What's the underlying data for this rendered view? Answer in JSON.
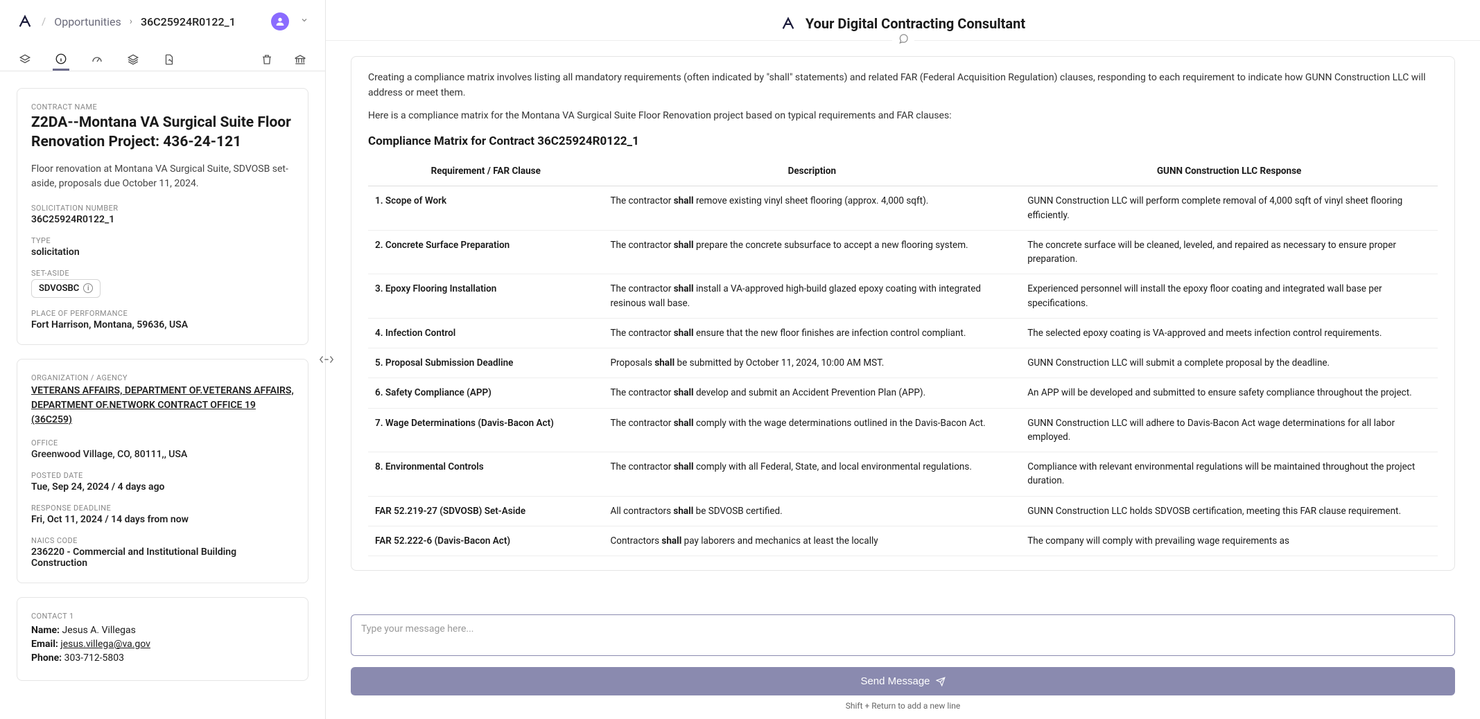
{
  "breadcrumb": {
    "root": "Opportunities",
    "id": "36C25924R0122_1"
  },
  "contract": {
    "label_name": "Contract Name",
    "name": "Z2DA--Montana VA Surgical Suite Floor Renovation Project: 436-24-121",
    "summary": "Floor renovation at Montana VA Surgical Suite, SDVOSB set-aside, proposals due October 11, 2024.",
    "label_solicitation": "SOLICITATION NUMBER",
    "solicitation": "36C25924R0122_1",
    "label_type": "TYPE",
    "type": "solicitation",
    "label_setaside": "SET-ASIDE",
    "setaside": "SDVOSBC",
    "label_pop": "PLACE OF PERFORMANCE",
    "pop": "Fort Harrison, Montana, 59636, USA"
  },
  "org": {
    "label_org": "ORGANIZATION / AGENCY",
    "name": "VETERANS AFFAIRS, DEPARTMENT OF.VETERANS AFFAIRS, DEPARTMENT OF.NETWORK CONTRACT OFFICE 19 (36C259)",
    "label_office": "OFFICE",
    "office": "Greenwood Village, CO, 80111,, USA",
    "label_posted": "POSTED DATE",
    "posted": "Tue, Sep 24, 2024 / 4 days ago",
    "label_deadline": "RESPONSE DEADLINE",
    "deadline": "Fri, Oct 11, 2024 / 14 days from now",
    "label_naics": "NAICS CODE",
    "naics": "236220 - Commercial and Institutional Building Construction"
  },
  "contact": {
    "heading": "Contact 1",
    "name_label": "Name:",
    "name": "Jesus A. Villegas",
    "email_label": "Email:",
    "email": "jesus.villega@va.gov",
    "phone_label": "Phone:",
    "phone": "303-712-5803"
  },
  "right": {
    "title": "Your Digital Contracting Consultant",
    "p1": "Creating a compliance matrix involves listing all mandatory requirements (often indicated by \"shall\" statements) and related FAR (Federal Acquisition Regulation) clauses, responding to each requirement to indicate how GUNN Construction LLC will address or meet them.",
    "p2": "Here is a compliance matrix for the Montana VA Surgical Suite Floor Renovation project based on typical requirements and FAR clauses:",
    "matrix_title": "Compliance Matrix for Contract 36C25924R0122_1",
    "headers": {
      "a": "Requirement / FAR Clause",
      "b": "Description",
      "c": "GUNN Construction LLC Response"
    },
    "rows": [
      {
        "a": "1. Scope of Work",
        "b_pre": "The contractor ",
        "b_shall": "shall",
        "b_post": " remove existing vinyl sheet flooring (approx. 4,000 sqft).",
        "c": "GUNN Construction LLC will perform complete removal of 4,000 sqft of vinyl sheet flooring efficiently."
      },
      {
        "a": "2. Concrete Surface Preparation",
        "b_pre": "The contractor ",
        "b_shall": "shall",
        "b_post": " prepare the concrete subsurface to accept a new flooring system.",
        "c": "The concrete surface will be cleaned, leveled, and repaired as necessary to ensure proper preparation."
      },
      {
        "a": "3. Epoxy Flooring Installation",
        "b_pre": "The contractor ",
        "b_shall": "shall",
        "b_post": " install a VA-approved high-build glazed epoxy coating with integrated resinous wall base.",
        "c": "Experienced personnel will install the epoxy floor coating and integrated wall base per specifications."
      },
      {
        "a": "4. Infection Control",
        "b_pre": "The contractor ",
        "b_shall": "shall",
        "b_post": " ensure that the new floor finishes are infection control compliant.",
        "c": "The selected epoxy coating is VA-approved and meets infection control requirements."
      },
      {
        "a": "5. Proposal Submission Deadline",
        "b_pre": "Proposals ",
        "b_shall": "shall",
        "b_post": " be submitted by October 11, 2024, 10:00 AM MST.",
        "c": "GUNN Construction LLC will submit a complete proposal by the deadline."
      },
      {
        "a": "6. Safety Compliance (APP)",
        "b_pre": "The contractor ",
        "b_shall": "shall",
        "b_post": " develop and submit an Accident Prevention Plan (APP).",
        "c": "An APP will be developed and submitted to ensure safety compliance throughout the project."
      },
      {
        "a": "7. Wage Determinations (Davis-Bacon Act)",
        "b_pre": "The contractor ",
        "b_shall": "shall",
        "b_post": " comply with the wage determinations outlined in the Davis-Bacon Act.",
        "c": "GUNN Construction LLC will adhere to Davis-Bacon Act wage determinations for all labor employed."
      },
      {
        "a": "8. Environmental Controls",
        "b_pre": "The contractor ",
        "b_shall": "shall",
        "b_post": " comply with all Federal, State, and local environmental regulations.",
        "c": "Compliance with relevant environmental regulations will be maintained throughout the project duration."
      },
      {
        "a": "FAR 52.219-27 (SDVOSB) Set-Aside",
        "b_pre": "All contractors ",
        "b_shall": "shall",
        "b_post": " be SDVOSB certified.",
        "c": "GUNN Construction LLC holds SDVOSB certification, meeting this FAR clause requirement."
      },
      {
        "a": "FAR 52.222-6 (Davis-Bacon Act)",
        "b_pre": "Contractors ",
        "b_shall": "shall",
        "b_post": " pay laborers and mechanics at least the locally",
        "c": "The company will comply with prevailing wage requirements as"
      }
    ]
  },
  "composer": {
    "placeholder": "Type your message here...",
    "send": "Send Message",
    "hint": "Shift + Return to add a new line"
  }
}
